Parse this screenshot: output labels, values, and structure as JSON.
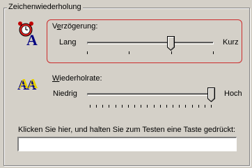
{
  "group": {
    "title": "Zeichenwiederholung"
  },
  "delay": {
    "label_prefix": "V",
    "label_mnemonic": "e",
    "label_rest": "rzögerung:",
    "min_label": "Lang",
    "max_label": "Kurz",
    "tick_count": 4,
    "value_fraction": 0.67,
    "icon": "clock-letter-a-icon"
  },
  "repeat_rate": {
    "label_mnemonic": "W",
    "label_rest": "iederholrate:",
    "min_label": "Niedrig",
    "max_label": "Hoch",
    "tick_count": 20,
    "value_fraction": 1.0,
    "icon": "letters-aa-icon"
  },
  "test_field": {
    "label": "Klicken Sie hier, und halten Sie zum Testen eine Taste gedrückt:",
    "value": ""
  },
  "colors": {
    "highlight_border": "#cc2b2b",
    "dialog_bg": "#d4d0c8"
  }
}
